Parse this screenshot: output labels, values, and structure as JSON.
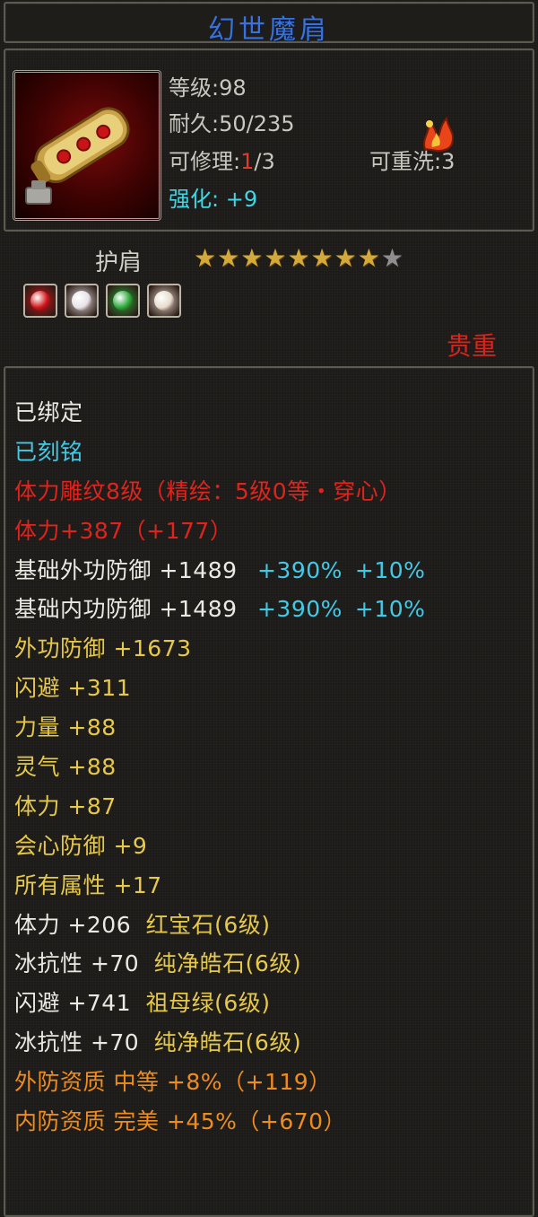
{
  "item": {
    "name": "幻世魔肩",
    "level_label": "等级:98",
    "durability_label": "耐久:50/235",
    "repair_prefix": "可修理:",
    "repair_used": "1",
    "repair_total": "/3",
    "rewash_label": "可重洗:3",
    "enhance_label": "强化: +9",
    "type": "护肩",
    "stars_filled": 8,
    "stars_total": 9,
    "rarity": "贵重",
    "icon": "gold-pauldron-icon",
    "badge_icon": "flame-rune-icon",
    "gems": [
      {
        "icon": "ruby-gem-icon",
        "color": "#d0151a"
      },
      {
        "icon": "pure-diamond-gem-icon",
        "color": "#e6e2e6"
      },
      {
        "icon": "emerald-gem-icon",
        "color": "#2aa83a"
      },
      {
        "icon": "pure-diamond-gem-icon",
        "color": "#e6dccc"
      }
    ]
  },
  "attributes": [
    {
      "class": "c-white",
      "parts": [
        "已绑定"
      ]
    },
    {
      "class": "c-cyan",
      "parts": [
        "已刻铭"
      ]
    },
    {
      "class": "c-red",
      "parts": [
        "体力雕纹8级（精绘：5级0等・穿心）"
      ]
    },
    {
      "class": "c-red",
      "parts": [
        "体力+387（+177）"
      ]
    },
    {
      "class": "c-white",
      "parts": [
        "基础外功防御 +1489 "
      ],
      "extra": [
        "+390%",
        "+10%"
      ]
    },
    {
      "class": "c-white",
      "parts": [
        "基础内功防御 +1489 "
      ],
      "extra": [
        "+390%",
        "+10%"
      ]
    },
    {
      "class": "c-gold",
      "parts": [
        "外功防御 +1673"
      ]
    },
    {
      "class": "c-gold",
      "parts": [
        "闪避 +311"
      ]
    },
    {
      "class": "c-gold",
      "parts": [
        "力量 +88"
      ]
    },
    {
      "class": "c-gold",
      "parts": [
        "灵气 +88"
      ]
    },
    {
      "class": "c-gold",
      "parts": [
        "体力 +87"
      ]
    },
    {
      "class": "c-gold",
      "parts": [
        "会心防御 +9"
      ]
    },
    {
      "class": "c-gold",
      "parts": [
        "所有属性 +17"
      ]
    },
    {
      "class": "c-white",
      "parts": [
        "体力 +206 "
      ],
      "gem": "红宝石(6级)"
    },
    {
      "class": "c-white",
      "parts": [
        "冰抗性 +70 "
      ],
      "gem": "纯净皓石(6级)"
    },
    {
      "class": "c-white",
      "parts": [
        "闪避 +741 "
      ],
      "gem": "祖母绿(6级)"
    },
    {
      "class": "c-white",
      "parts": [
        "冰抗性 +70 "
      ],
      "gem": "纯净皓石(6级)"
    },
    {
      "class": "c-orange",
      "parts": [
        "外防资质 中等 +8%（+119）"
      ]
    },
    {
      "class": "c-orange",
      "parts": [
        "内防资质 完美 +45%（+670）"
      ]
    }
  ],
  "colors": {
    "title_blue": "#3a72d8",
    "cyan_percent": "#42c9e6",
    "gem_name_gold": "#e6c84a"
  }
}
